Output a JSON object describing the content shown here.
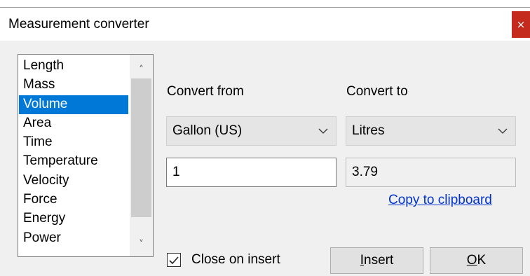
{
  "window": {
    "title": "Measurement converter",
    "close_glyph": "×"
  },
  "categories": {
    "items": [
      "Length",
      "Mass",
      "Volume",
      "Area",
      "Time",
      "Temperature",
      "Velocity",
      "Force",
      "Energy",
      "Power"
    ],
    "selected": "Volume"
  },
  "converter": {
    "from_label": "Convert from",
    "to_label": "Convert to",
    "from_unit": "Gallon (US)",
    "to_unit": "Litres",
    "from_value": "1",
    "to_value": "3.79",
    "copy_link": "Copy to clipboard"
  },
  "footer": {
    "close_on_insert_label": "Close on insert",
    "close_on_insert_checked": true,
    "insert_mnemonic": "I",
    "insert_rest": "nsert",
    "ok_mnemonic": "O",
    "ok_rest": "K"
  },
  "colors": {
    "selection": "#0078d7",
    "close_button": "#c42b1c",
    "link": "#0033cc"
  },
  "icons": {
    "scroll_up": "▲",
    "scroll_down": "▼",
    "dropdown": "chevron-down",
    "check": "✓"
  }
}
